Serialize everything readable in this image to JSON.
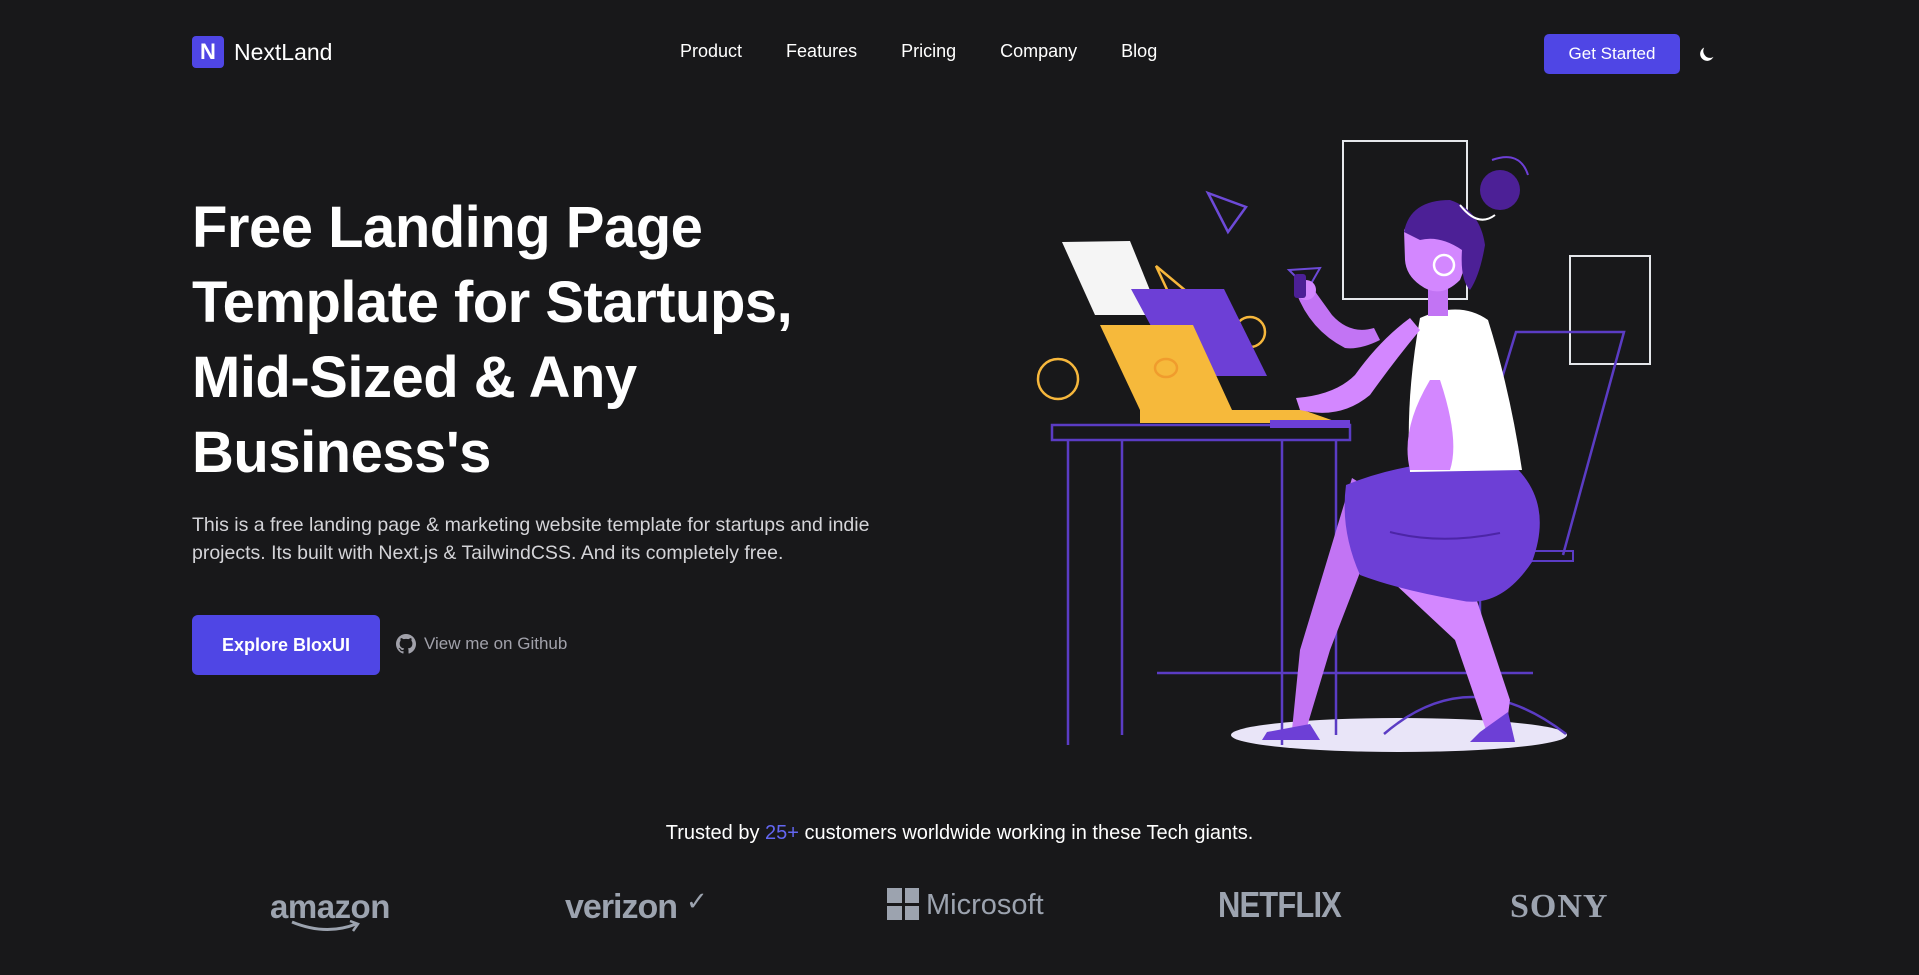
{
  "nav": {
    "logo_letter": "N",
    "logo_text": "NextLand",
    "menu": [
      "Product",
      "Features",
      "Pricing",
      "Company",
      "Blog"
    ],
    "cta_label": "Get Started",
    "theme_icon": "moon-icon"
  },
  "hero": {
    "title": "Free Landing Page Template for Startups, Mid-Sized & Any Business's",
    "description": "This is a free landing page & marketing website template for startups and indie projects. Its built with Next.js & TailwindCSS. And its completely free.",
    "primary_button": "Explore BloxUI",
    "github_link": "View me on Github",
    "github_icon": "github-icon"
  },
  "trusted": {
    "prefix": "Trusted by",
    "count": "25+",
    "suffix": "customers worldwide working in these Tech giants."
  },
  "brands": [
    "amazon",
    "verizon",
    "Microsoft",
    "NETFLIX",
    "SONY"
  ],
  "colors": {
    "background": "#18181a",
    "accent": "#4f46e5",
    "highlight": "#6366f1",
    "muted": "#9ca3af"
  }
}
